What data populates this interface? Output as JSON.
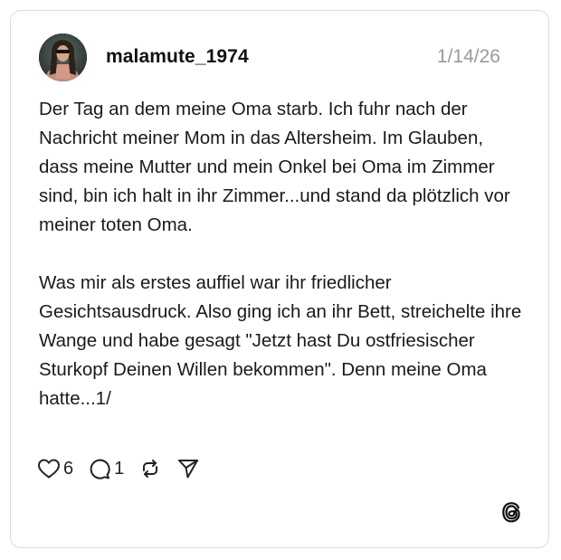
{
  "post": {
    "username": "malamute_1974",
    "date": "1/14/26",
    "paragraphs": [
      "Der Tag an dem meine Oma starb. Ich fuhr nach der Nachricht meiner Mom in das Altersheim. Im Glauben, dass meine Mutter und mein Onkel bei Oma im Zimmer sind, bin ich halt in ihr Zimmer...und stand da plötzlich vor meiner toten Oma.",
      "Was mir als erstes auffiel war ihr friedlicher Gesichtsausdruck. Also ging ich an ihr Bett, streichelte ihre Wange und habe gesagt \"Jetzt hast Du ostfriesischer Sturkopf Deinen Willen bekommen\". Denn meine Oma hatte...1/"
    ]
  },
  "actions": {
    "likes": "6",
    "comments": "1"
  },
  "icons": {
    "like": "heart-icon",
    "comment": "comment-bubble-icon",
    "repost": "repost-icon",
    "share": "send-icon",
    "brand": "threads-logo-icon"
  },
  "colors": {
    "text": "#1a1a1a",
    "muted": "#9a9a9a",
    "border": "#dcdcdc"
  }
}
